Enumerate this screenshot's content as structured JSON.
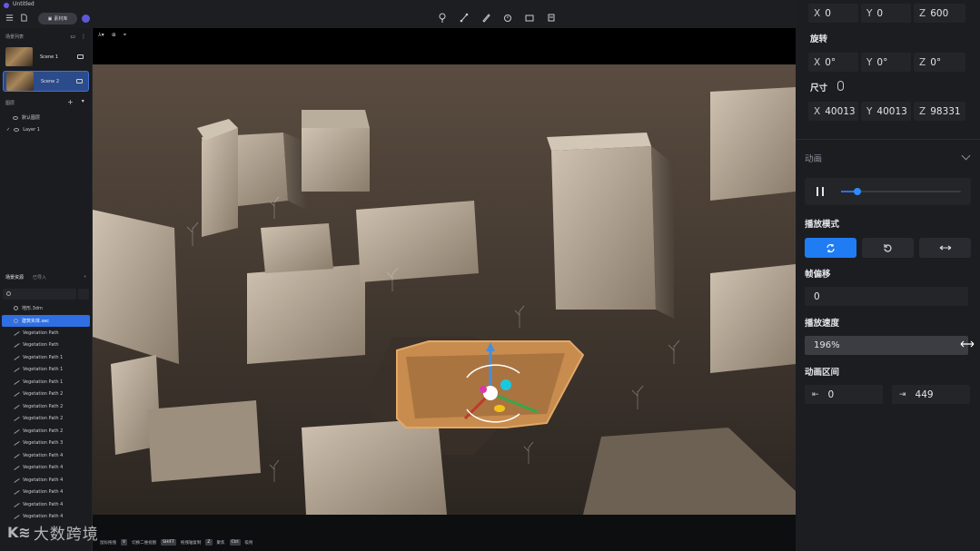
{
  "app": {
    "title": "Untitled"
  },
  "header": {
    "scene_pill_label": "素材库",
    "tools": [
      "light-bulb-icon",
      "link-tool-icon",
      "paint-icon",
      "timer-icon",
      "camera-icon",
      "gear-tool-icon"
    ]
  },
  "scenes": {
    "title": "场景列表",
    "items": [
      {
        "label": "Scene 1"
      },
      {
        "label": "Scene 2",
        "active": true
      }
    ]
  },
  "layers": {
    "title": "图层",
    "items": [
      {
        "label": "默认图层"
      },
      {
        "label": "Layer 1"
      }
    ]
  },
  "resources": {
    "tabs": [
      "场景资源",
      "已导入"
    ],
    "search_placeholder": "",
    "items": [
      {
        "label": "地形.3dm",
        "kind": "file"
      },
      {
        "label": "建筑实体.sec",
        "kind": "file",
        "selected": true
      },
      {
        "label": "Vegetation Path",
        "kind": "path"
      },
      {
        "label": "Vegetation Path",
        "kind": "path"
      },
      {
        "label": "Vegetation Path 1",
        "kind": "path"
      },
      {
        "label": "Vegetation Path 1",
        "kind": "path"
      },
      {
        "label": "Vegetation Path 1",
        "kind": "path"
      },
      {
        "label": "Vegetation Path 2",
        "kind": "path"
      },
      {
        "label": "Vegetation Path 2",
        "kind": "path"
      },
      {
        "label": "Vegetation Path 2",
        "kind": "path"
      },
      {
        "label": "Vegetation Path 2",
        "kind": "path"
      },
      {
        "label": "Vegetation Path 3",
        "kind": "path"
      },
      {
        "label": "Vegetation Path 4",
        "kind": "path"
      },
      {
        "label": "Vegetation Path 4",
        "kind": "path"
      },
      {
        "label": "Vegetation Path 4",
        "kind": "path"
      },
      {
        "label": "Vegetation Path 4",
        "kind": "path"
      },
      {
        "label": "Vegetation Path 4",
        "kind": "path"
      },
      {
        "label": "Vegetation Path 4",
        "kind": "path"
      }
    ]
  },
  "statusbar": {
    "hints": [
      {
        "key": "",
        "text": "鼠标拖拽"
      },
      {
        "key": "V",
        "text": "切换二维视图"
      },
      {
        "key": "SHIFT",
        "text": "拖拽轴复制"
      },
      {
        "key": "Z",
        "text": "聚焦"
      },
      {
        "key": "Ctrl",
        "text": "吸附"
      }
    ],
    "watermark": "大数跨境"
  },
  "properties": {
    "position": {
      "x": "0",
      "y": "0",
      "z": "600"
    },
    "rotation_label": "旋转",
    "rotation": {
      "x": "0°",
      "y": "0°",
      "z": "0°"
    },
    "size_label": "尺寸",
    "size": {
      "x": "40013",
      "y": "40013",
      "z": "98331"
    },
    "axis_x": "X",
    "axis_y": "Y",
    "axis_z": "Z"
  },
  "animation": {
    "title": "动画",
    "progress": 0.14,
    "play_mode_label": "播放模式",
    "play_modes": [
      "loop-icon",
      "replay-icon",
      "ping-pong-icon"
    ],
    "active_mode": 0,
    "frame_offset_label": "帧偏移",
    "frame_offset": "0",
    "speed_label": "播放速度",
    "speed": "196%",
    "range_label": "动画区间",
    "range_start": "0",
    "range_end": "449",
    "accent": "#1f7cf2"
  }
}
